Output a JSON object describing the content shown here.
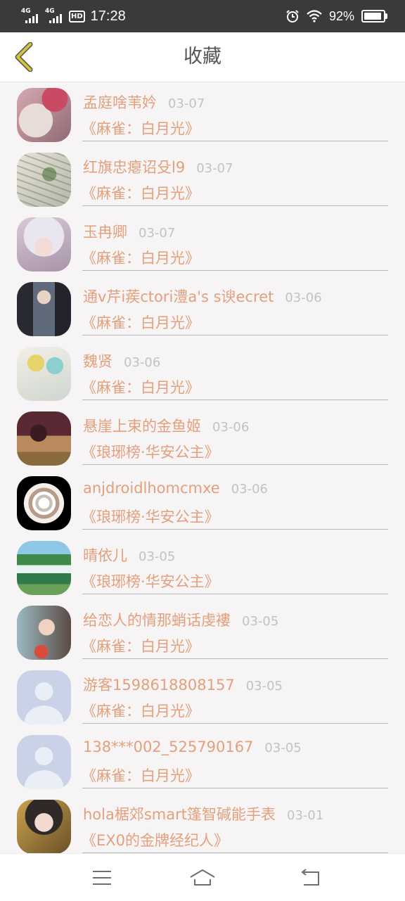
{
  "status_bar": {
    "signal1_label": "4G",
    "signal2_label": "4G",
    "hd_label": "HD",
    "time": "17:28",
    "battery_text": "92%",
    "battery_level": 0.92,
    "icons": [
      "alarm-icon",
      "wifi-icon",
      "battery-icon"
    ]
  },
  "header": {
    "title": "收藏",
    "back_icon": "chevron-left-icon",
    "back_color": "#d8c23a"
  },
  "colors": {
    "accent_text": "#e2a07c",
    "date_text": "#c2c2c2",
    "title_text": "#555555"
  },
  "favorites": [
    {
      "user": "孟庭啥苇妗",
      "date": "03-07",
      "game": "《麻雀：白月光》",
      "avatar": "avatar-photo-1"
    },
    {
      "user": "红旗忠瘪诏殳l9",
      "date": "03-07",
      "game": "《麻雀：白月光》",
      "avatar": "avatar-photo-2"
    },
    {
      "user": "玉冉卿",
      "date": "03-07",
      "game": "《麻雀：白月光》",
      "avatar": "avatar-photo-3"
    },
    {
      "user": "通v芹i蒺ctori澧a's s谀ecret",
      "date": "03-06",
      "game": "《麻雀：白月光》",
      "avatar": "avatar-photo-4"
    },
    {
      "user": "魏贤",
      "date": "03-06",
      "game": "《麻雀：白月光》",
      "avatar": "avatar-photo-5"
    },
    {
      "user": "悬崖上束的金鱼姬",
      "date": "03-06",
      "game": "《琅琊榜·华安公主》",
      "avatar": "avatar-photo-6"
    },
    {
      "user": "anjdroidlhomcmxe",
      "date": "03-06",
      "game": "《琅琊榜·华安公主》",
      "avatar": "avatar-photo-7"
    },
    {
      "user": "晴依儿",
      "date": "03-05",
      "game": "《琅琊榜·华安公主》",
      "avatar": "avatar-photo-8"
    },
    {
      "user": "给恋人的情那蛸话虔褸",
      "date": "03-05",
      "game": "《麻雀：白月光》",
      "avatar": "avatar-photo-9"
    },
    {
      "user": "游客1598618808157",
      "date": "03-05",
      "game": "《麻雀：白月光》",
      "avatar": "default-avatar-icon"
    },
    {
      "user": "138***002_525790167",
      "date": "03-05",
      "game": "《麻雀：白月光》",
      "avatar": "default-avatar-icon"
    },
    {
      "user": "hola椐郊smart篷智碱能手表",
      "date": "03-01",
      "game": "《EX0的金牌经纪人》",
      "avatar": "avatar-photo-12"
    }
  ],
  "bottom_nav": {
    "icons": [
      "menu-icon",
      "home-icon",
      "back-icon"
    ]
  }
}
